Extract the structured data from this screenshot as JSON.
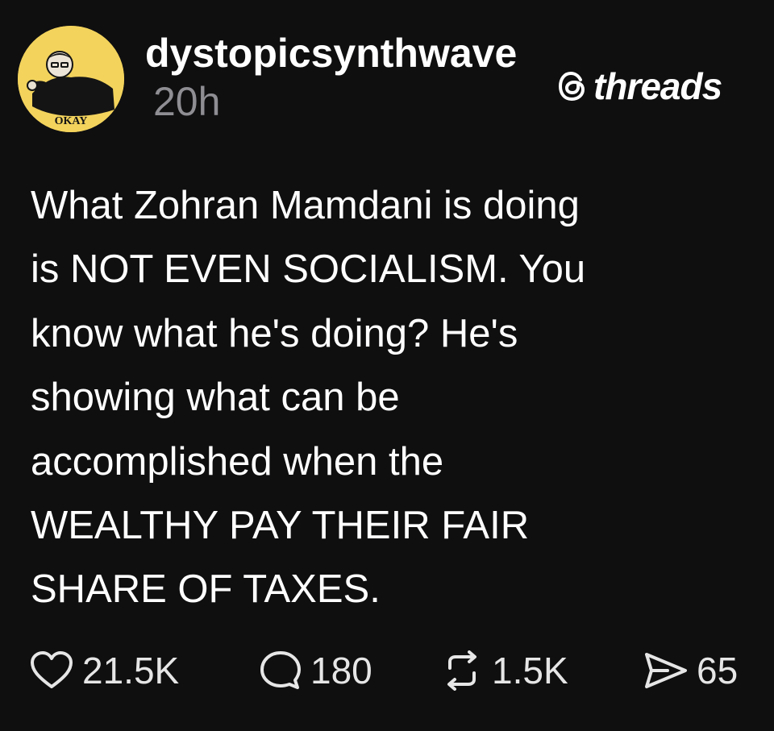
{
  "post": {
    "username": "dystopicsynthwave",
    "timestamp": "20h",
    "avatar_label": "OKAY",
    "brand": {
      "name": "threads",
      "icon": "threads-logo-icon"
    },
    "text": "What Zohran Mamdani is doing\nis NOT EVEN SOCIALISM. You\nknow what he's doing? He's\nshowing what can be\naccomplished when the\nWEALTHY PAY THEIR FAIR\nSHARE OF TAXES.",
    "stats": {
      "likes": "21.5K",
      "replies": "180",
      "reposts": "1.5K",
      "shares": "65"
    }
  },
  "colors": {
    "background": "#0f0f10",
    "text": "#ffffff",
    "muted": "#8e8e93",
    "avatar_bg": "#f3d35c"
  }
}
